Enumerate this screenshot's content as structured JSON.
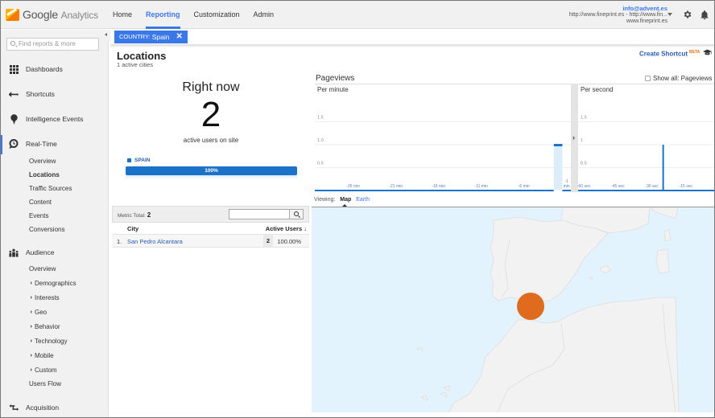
{
  "header": {
    "logo_brand": "Google",
    "logo_product": "Analytics",
    "nav": [
      {
        "label": "Home",
        "active": false
      },
      {
        "label": "Reporting",
        "active": true
      },
      {
        "label": "Customization",
        "active": false
      },
      {
        "label": "Admin",
        "active": false
      }
    ],
    "account_email": "info@advent.es",
    "account_property": "http://www.fineprint.es - http://www.fin...",
    "account_view": "www.fineprint.es"
  },
  "sidebar": {
    "search_placeholder": "Find reports & more",
    "sections": {
      "dashboards": "Dashboards",
      "shortcuts": "Shortcuts",
      "intelligence": "Intelligence Events",
      "realtime": "Real-Time",
      "audience": "Audience",
      "acquisition": "Acquisition"
    },
    "realtime_items": [
      "Overview",
      "Locations",
      "Traffic Sources",
      "Content",
      "Events",
      "Conversions"
    ],
    "audience_items": [
      "Overview",
      "Demographics",
      "Interests",
      "Geo",
      "Behavior",
      "Technology",
      "Mobile",
      "Custom",
      "Users Flow"
    ]
  },
  "filter": {
    "label": "COUNTRY:",
    "value": "Spain"
  },
  "page": {
    "title": "Locations",
    "subtitle": "1 active cities",
    "create_shortcut": "Create Shortcut",
    "beta": "BETA"
  },
  "right_now": {
    "title": "Right now",
    "count": "2",
    "label": "active users on site",
    "country": "SPAIN",
    "percent_label": "100%",
    "percent": 100
  },
  "pageviews": {
    "title": "Pageviews",
    "show_all": "Show all: Pageviews",
    "show_all_checked": false,
    "per_minute_label": "Per minute",
    "per_second_label": "Per second"
  },
  "chart_data": [
    {
      "type": "bar",
      "title": "Per minute",
      "ylabel": "Pageviews",
      "ylim": [
        0,
        2
      ],
      "yticks": [
        "0.5",
        "1.0",
        "1.5"
      ],
      "x_tick_labels": [
        "-26 min",
        "-21 min",
        "-16 min",
        "-11 min",
        "-6 min",
        "-1 min"
      ],
      "x": [
        -30,
        -29,
        -28,
        -27,
        -26,
        -25,
        -24,
        -23,
        -22,
        -21,
        -20,
        -19,
        -18,
        -17,
        -16,
        -15,
        -14,
        -13,
        -12,
        -11,
        -10,
        -9,
        -8,
        -7,
        -6,
        -5,
        -4,
        -3,
        -2,
        -1
      ],
      "values": [
        0,
        0,
        0,
        0,
        0,
        0,
        0,
        0,
        0,
        0,
        0,
        0,
        0,
        0,
        0,
        0,
        0,
        0,
        0,
        0,
        0,
        0,
        0,
        0,
        0,
        0,
        0,
        0,
        1,
        0
      ],
      "highlight_index": 28
    },
    {
      "type": "bar",
      "title": "Per second",
      "ylabel": "Pageviews",
      "ylim": [
        0,
        2
      ],
      "yticks": [
        "0.5",
        "1",
        "1.5"
      ],
      "x_tick_labels": [
        "-60 sec",
        "-45 sec",
        "-30 sec",
        "-15 sec"
      ],
      "x": [
        -60,
        -55,
        -50,
        -45,
        -40,
        -35,
        -30,
        -25,
        -20,
        -15,
        -10,
        -5
      ],
      "values": [
        0,
        0,
        0,
        0,
        0,
        0,
        0,
        1,
        0,
        0,
        0,
        0
      ]
    }
  ],
  "viewing": {
    "label": "Viewing:",
    "options": [
      "Map",
      "Earth"
    ],
    "selected": "Map"
  },
  "table": {
    "metric_total_label": "Metric Total:",
    "metric_total": "2",
    "search_value": "",
    "columns": [
      "City",
      "Active Users"
    ],
    "rows": [
      {
        "index": "1.",
        "city": "San Pedro Alcantara",
        "active_users": "2",
        "percent": "100.00%"
      }
    ]
  },
  "map": {
    "marker_city": "San Pedro Alcantara",
    "marker_color": "#e06b1f",
    "water_color": "#e3f3fd",
    "land_color": "#f2f2f2"
  }
}
